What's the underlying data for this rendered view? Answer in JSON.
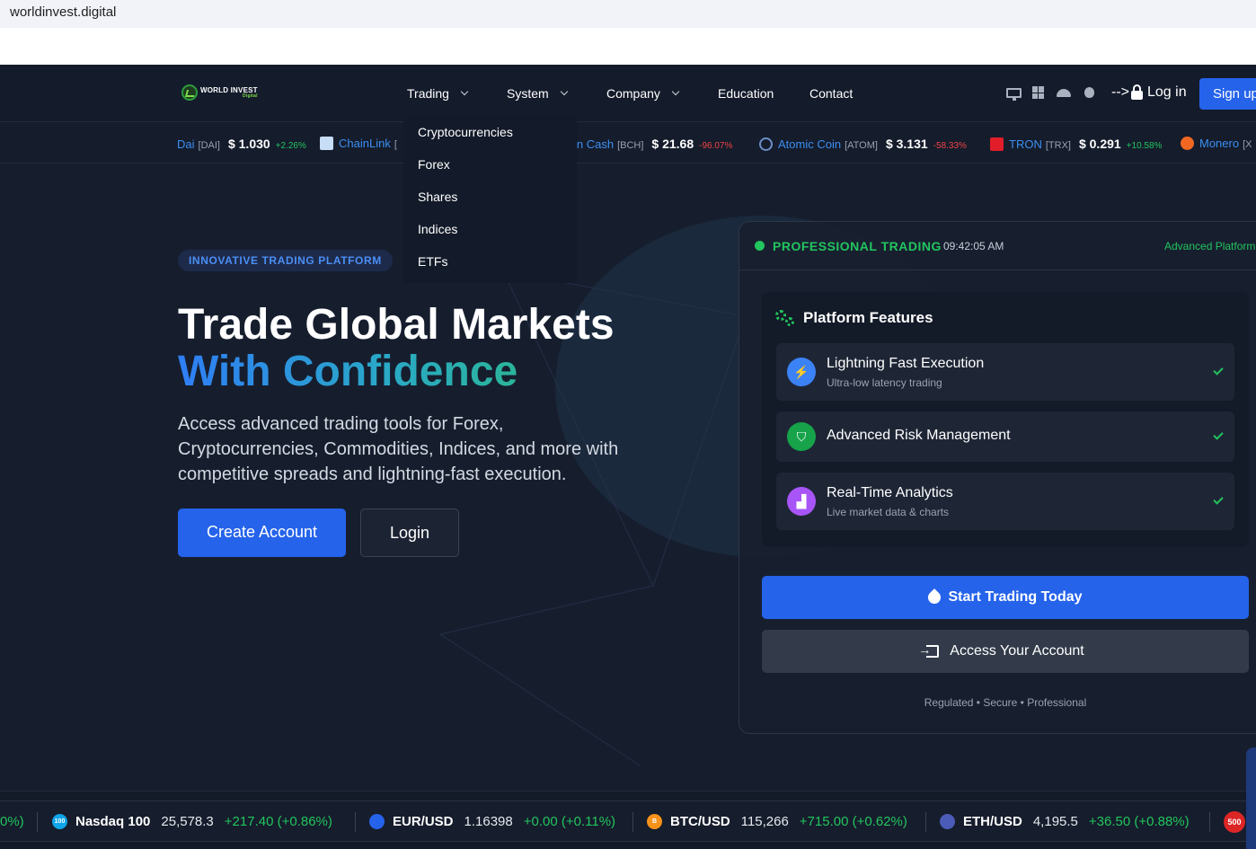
{
  "browser": {
    "url": "worldinvest.digital"
  },
  "logo": {
    "name": "WORLD INVEST",
    "sub": "Digital"
  },
  "nav": {
    "items": [
      {
        "label": "Trading",
        "has_menu": true
      },
      {
        "label": "System",
        "has_menu": true
      },
      {
        "label": "Company",
        "has_menu": true
      },
      {
        "label": "Education",
        "has_menu": false
      },
      {
        "label": "Contact",
        "has_menu": false
      }
    ],
    "login_prefix": "-->",
    "login": "Log in",
    "signup": "Sign up"
  },
  "trading_menu": [
    "Cryptocurrencies",
    "Forex",
    "Shares",
    "Indices",
    "ETFs"
  ],
  "ticker_top": [
    {
      "name": "Dai",
      "symbol": "[DAI]",
      "price": "$ 1.030",
      "change": "+2.26%",
      "dir": "up"
    },
    {
      "name": "ChainLink",
      "symbol": "[",
      "price": "",
      "change": "",
      "dir": "up"
    },
    {
      "name": "in Cash",
      "symbol": "[BCH]",
      "price": "$ 21.68",
      "change": "-96.07%",
      "dir": "down"
    },
    {
      "name": "Atomic Coin",
      "symbol": "[ATOM]",
      "price": "$ 3.131",
      "change": "-58.33%",
      "dir": "down"
    },
    {
      "name": "TRON",
      "symbol": "[TRX]",
      "price": "$ 0.291",
      "change": "+10.58%",
      "dir": "up"
    },
    {
      "name": "Monero",
      "symbol": "[X",
      "price": "",
      "change": "",
      "dir": "up"
    }
  ],
  "hero": {
    "badge": "INNOVATIVE TRADING PLATFORM",
    "title_line1": "Trade Global Markets",
    "title_line2": "With Confidence",
    "subtitle": "Access advanced trading tools for Forex, Cryptocurrencies, Commodities, Indices, and more with competitive spreads and lightning-fast execution.",
    "create_account": "Create Account",
    "login": "Login"
  },
  "card": {
    "status": "PROFESSIONAL TRADING",
    "time": "09:42:05 AM",
    "tag": "Advanced Platform",
    "features_title": "Platform Features",
    "features": [
      {
        "title": "Lightning Fast Execution",
        "sub": "Ultra-low latency trading",
        "icon": "bolt-icon",
        "color": "#3b82f6"
      },
      {
        "title": "Advanced Risk Management",
        "sub": "",
        "icon": "shield-icon",
        "color": "#16a34a"
      },
      {
        "title": "Real-Time Analytics",
        "sub": "Live market data & charts",
        "icon": "chart-icon",
        "color": "#a855f7"
      }
    ],
    "start_button": "Start Trading Today",
    "access_button": "Access Your Account",
    "footer": "Regulated • Secure • Professional"
  },
  "ticker_bottom": [
    {
      "name": "",
      "price": "",
      "change": "0%)",
      "icon_color": ""
    },
    {
      "name": "Nasdaq 100",
      "price": "25,578.3",
      "change": "+217.40 (+0.86%)",
      "icon_color": "#0ea5e9",
      "icon_text": "100"
    },
    {
      "name": "EUR/USD",
      "price": "1.16398",
      "change": "+0.00 (+0.11%)",
      "icon_color": "#2563eb",
      "icon_text": ""
    },
    {
      "name": "BTC/USD",
      "price": "115,266",
      "change": "+715.00 (+0.62%)",
      "icon_color": "#f7931a",
      "icon_text": "B"
    },
    {
      "name": "ETH/USD",
      "price": "4,195.5",
      "change": "+36.50 (+0.88%)",
      "icon_color": "#4b5bb8",
      "icon_text": ""
    }
  ],
  "ticker_badge": "500"
}
